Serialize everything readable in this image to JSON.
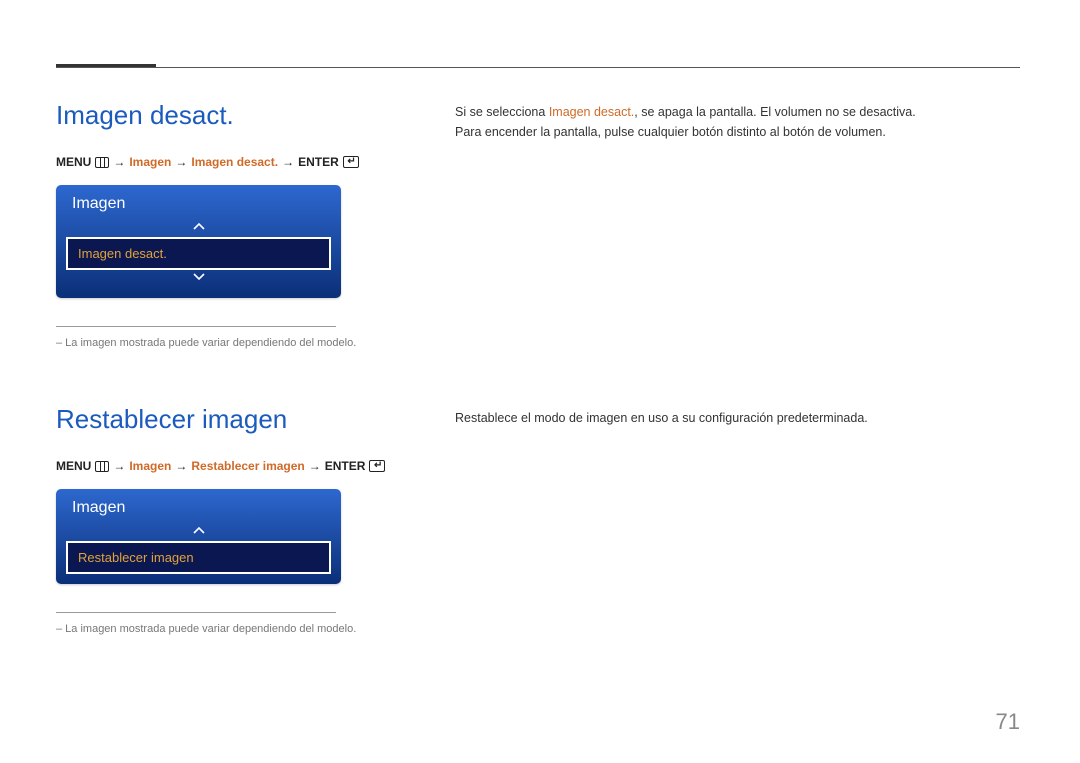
{
  "page_number": "71",
  "section1": {
    "heading": "Imagen desact.",
    "breadcrumb": {
      "menu": "MENU",
      "arrow": "→",
      "p1": "Imagen",
      "p2": "Imagen desact.",
      "enter": "ENTER"
    },
    "osd": {
      "title": "Imagen",
      "selected": "Imagen desact."
    },
    "note": "–  La imagen mostrada puede variar dependiendo del modelo.",
    "desc_pre": "Si se selecciona ",
    "desc_highlight": "Imagen desact.",
    "desc_post": ", se apaga la pantalla. El volumen no se desactiva.",
    "desc_line2": "Para encender la pantalla, pulse cualquier botón distinto al botón de volumen."
  },
  "section2": {
    "heading": "Restablecer imagen",
    "breadcrumb": {
      "menu": "MENU",
      "arrow": "→",
      "p1": "Imagen",
      "p2": "Restablecer imagen",
      "enter": "ENTER"
    },
    "osd": {
      "title": "Imagen",
      "selected": "Restablecer imagen"
    },
    "note": "–  La imagen mostrada puede variar dependiendo del modelo.",
    "desc": "Restablece el modo de imagen en uso a su configuración predeterminada."
  }
}
